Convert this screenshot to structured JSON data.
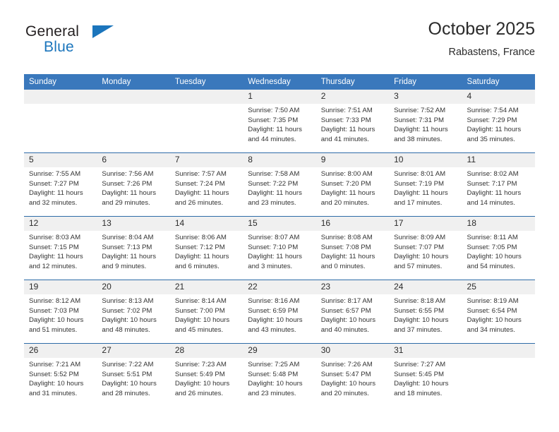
{
  "logo": {
    "word_one": "General",
    "word_two": "Blue",
    "flag_icon": "blue-triangle-flag-icon",
    "colors": {
      "dark": "#231f20",
      "blue": "#1b75bc"
    }
  },
  "header": {
    "title": "October 2025",
    "subtitle": "Rabastens, France"
  },
  "theme": {
    "header_row_bg": "#3a78bc",
    "row_divider": "#2e6ca8",
    "daynum_bg": "#f0f0f0",
    "text": "#333333"
  },
  "weekday_headers": [
    "Sunday",
    "Monday",
    "Tuesday",
    "Wednesday",
    "Thursday",
    "Friday",
    "Saturday"
  ],
  "weeks": [
    [
      {
        "day": "",
        "sunrise": "",
        "sunset": "",
        "daylight_line1": "",
        "daylight_line2": ""
      },
      {
        "day": "",
        "sunrise": "",
        "sunset": "",
        "daylight_line1": "",
        "daylight_line2": ""
      },
      {
        "day": "",
        "sunrise": "",
        "sunset": "",
        "daylight_line1": "",
        "daylight_line2": ""
      },
      {
        "day": "1",
        "sunrise": "Sunrise: 7:50 AM",
        "sunset": "Sunset: 7:35 PM",
        "daylight_line1": "Daylight: 11 hours",
        "daylight_line2": "and 44 minutes."
      },
      {
        "day": "2",
        "sunrise": "Sunrise: 7:51 AM",
        "sunset": "Sunset: 7:33 PM",
        "daylight_line1": "Daylight: 11 hours",
        "daylight_line2": "and 41 minutes."
      },
      {
        "day": "3",
        "sunrise": "Sunrise: 7:52 AM",
        "sunset": "Sunset: 7:31 PM",
        "daylight_line1": "Daylight: 11 hours",
        "daylight_line2": "and 38 minutes."
      },
      {
        "day": "4",
        "sunrise": "Sunrise: 7:54 AM",
        "sunset": "Sunset: 7:29 PM",
        "daylight_line1": "Daylight: 11 hours",
        "daylight_line2": "and 35 minutes."
      }
    ],
    [
      {
        "day": "5",
        "sunrise": "Sunrise: 7:55 AM",
        "sunset": "Sunset: 7:27 PM",
        "daylight_line1": "Daylight: 11 hours",
        "daylight_line2": "and 32 minutes."
      },
      {
        "day": "6",
        "sunrise": "Sunrise: 7:56 AM",
        "sunset": "Sunset: 7:26 PM",
        "daylight_line1": "Daylight: 11 hours",
        "daylight_line2": "and 29 minutes."
      },
      {
        "day": "7",
        "sunrise": "Sunrise: 7:57 AM",
        "sunset": "Sunset: 7:24 PM",
        "daylight_line1": "Daylight: 11 hours",
        "daylight_line2": "and 26 minutes."
      },
      {
        "day": "8",
        "sunrise": "Sunrise: 7:58 AM",
        "sunset": "Sunset: 7:22 PM",
        "daylight_line1": "Daylight: 11 hours",
        "daylight_line2": "and 23 minutes."
      },
      {
        "day": "9",
        "sunrise": "Sunrise: 8:00 AM",
        "sunset": "Sunset: 7:20 PM",
        "daylight_line1": "Daylight: 11 hours",
        "daylight_line2": "and 20 minutes."
      },
      {
        "day": "10",
        "sunrise": "Sunrise: 8:01 AM",
        "sunset": "Sunset: 7:19 PM",
        "daylight_line1": "Daylight: 11 hours",
        "daylight_line2": "and 17 minutes."
      },
      {
        "day": "11",
        "sunrise": "Sunrise: 8:02 AM",
        "sunset": "Sunset: 7:17 PM",
        "daylight_line1": "Daylight: 11 hours",
        "daylight_line2": "and 14 minutes."
      }
    ],
    [
      {
        "day": "12",
        "sunrise": "Sunrise: 8:03 AM",
        "sunset": "Sunset: 7:15 PM",
        "daylight_line1": "Daylight: 11 hours",
        "daylight_line2": "and 12 minutes."
      },
      {
        "day": "13",
        "sunrise": "Sunrise: 8:04 AM",
        "sunset": "Sunset: 7:13 PM",
        "daylight_line1": "Daylight: 11 hours",
        "daylight_line2": "and 9 minutes."
      },
      {
        "day": "14",
        "sunrise": "Sunrise: 8:06 AM",
        "sunset": "Sunset: 7:12 PM",
        "daylight_line1": "Daylight: 11 hours",
        "daylight_line2": "and 6 minutes."
      },
      {
        "day": "15",
        "sunrise": "Sunrise: 8:07 AM",
        "sunset": "Sunset: 7:10 PM",
        "daylight_line1": "Daylight: 11 hours",
        "daylight_line2": "and 3 minutes."
      },
      {
        "day": "16",
        "sunrise": "Sunrise: 8:08 AM",
        "sunset": "Sunset: 7:08 PM",
        "daylight_line1": "Daylight: 11 hours",
        "daylight_line2": "and 0 minutes."
      },
      {
        "day": "17",
        "sunrise": "Sunrise: 8:09 AM",
        "sunset": "Sunset: 7:07 PM",
        "daylight_line1": "Daylight: 10 hours",
        "daylight_line2": "and 57 minutes."
      },
      {
        "day": "18",
        "sunrise": "Sunrise: 8:11 AM",
        "sunset": "Sunset: 7:05 PM",
        "daylight_line1": "Daylight: 10 hours",
        "daylight_line2": "and 54 minutes."
      }
    ],
    [
      {
        "day": "19",
        "sunrise": "Sunrise: 8:12 AM",
        "sunset": "Sunset: 7:03 PM",
        "daylight_line1": "Daylight: 10 hours",
        "daylight_line2": "and 51 minutes."
      },
      {
        "day": "20",
        "sunrise": "Sunrise: 8:13 AM",
        "sunset": "Sunset: 7:02 PM",
        "daylight_line1": "Daylight: 10 hours",
        "daylight_line2": "and 48 minutes."
      },
      {
        "day": "21",
        "sunrise": "Sunrise: 8:14 AM",
        "sunset": "Sunset: 7:00 PM",
        "daylight_line1": "Daylight: 10 hours",
        "daylight_line2": "and 45 minutes."
      },
      {
        "day": "22",
        "sunrise": "Sunrise: 8:16 AM",
        "sunset": "Sunset: 6:59 PM",
        "daylight_line1": "Daylight: 10 hours",
        "daylight_line2": "and 43 minutes."
      },
      {
        "day": "23",
        "sunrise": "Sunrise: 8:17 AM",
        "sunset": "Sunset: 6:57 PM",
        "daylight_line1": "Daylight: 10 hours",
        "daylight_line2": "and 40 minutes."
      },
      {
        "day": "24",
        "sunrise": "Sunrise: 8:18 AM",
        "sunset": "Sunset: 6:55 PM",
        "daylight_line1": "Daylight: 10 hours",
        "daylight_line2": "and 37 minutes."
      },
      {
        "day": "25",
        "sunrise": "Sunrise: 8:19 AM",
        "sunset": "Sunset: 6:54 PM",
        "daylight_line1": "Daylight: 10 hours",
        "daylight_line2": "and 34 minutes."
      }
    ],
    [
      {
        "day": "26",
        "sunrise": "Sunrise: 7:21 AM",
        "sunset": "Sunset: 5:52 PM",
        "daylight_line1": "Daylight: 10 hours",
        "daylight_line2": "and 31 minutes."
      },
      {
        "day": "27",
        "sunrise": "Sunrise: 7:22 AM",
        "sunset": "Sunset: 5:51 PM",
        "daylight_line1": "Daylight: 10 hours",
        "daylight_line2": "and 28 minutes."
      },
      {
        "day": "28",
        "sunrise": "Sunrise: 7:23 AM",
        "sunset": "Sunset: 5:49 PM",
        "daylight_line1": "Daylight: 10 hours",
        "daylight_line2": "and 26 minutes."
      },
      {
        "day": "29",
        "sunrise": "Sunrise: 7:25 AM",
        "sunset": "Sunset: 5:48 PM",
        "daylight_line1": "Daylight: 10 hours",
        "daylight_line2": "and 23 minutes."
      },
      {
        "day": "30",
        "sunrise": "Sunrise: 7:26 AM",
        "sunset": "Sunset: 5:47 PM",
        "daylight_line1": "Daylight: 10 hours",
        "daylight_line2": "and 20 minutes."
      },
      {
        "day": "31",
        "sunrise": "Sunrise: 7:27 AM",
        "sunset": "Sunset: 5:45 PM",
        "daylight_line1": "Daylight: 10 hours",
        "daylight_line2": "and 18 minutes."
      },
      {
        "day": "",
        "sunrise": "",
        "sunset": "",
        "daylight_line1": "",
        "daylight_line2": ""
      }
    ]
  ]
}
